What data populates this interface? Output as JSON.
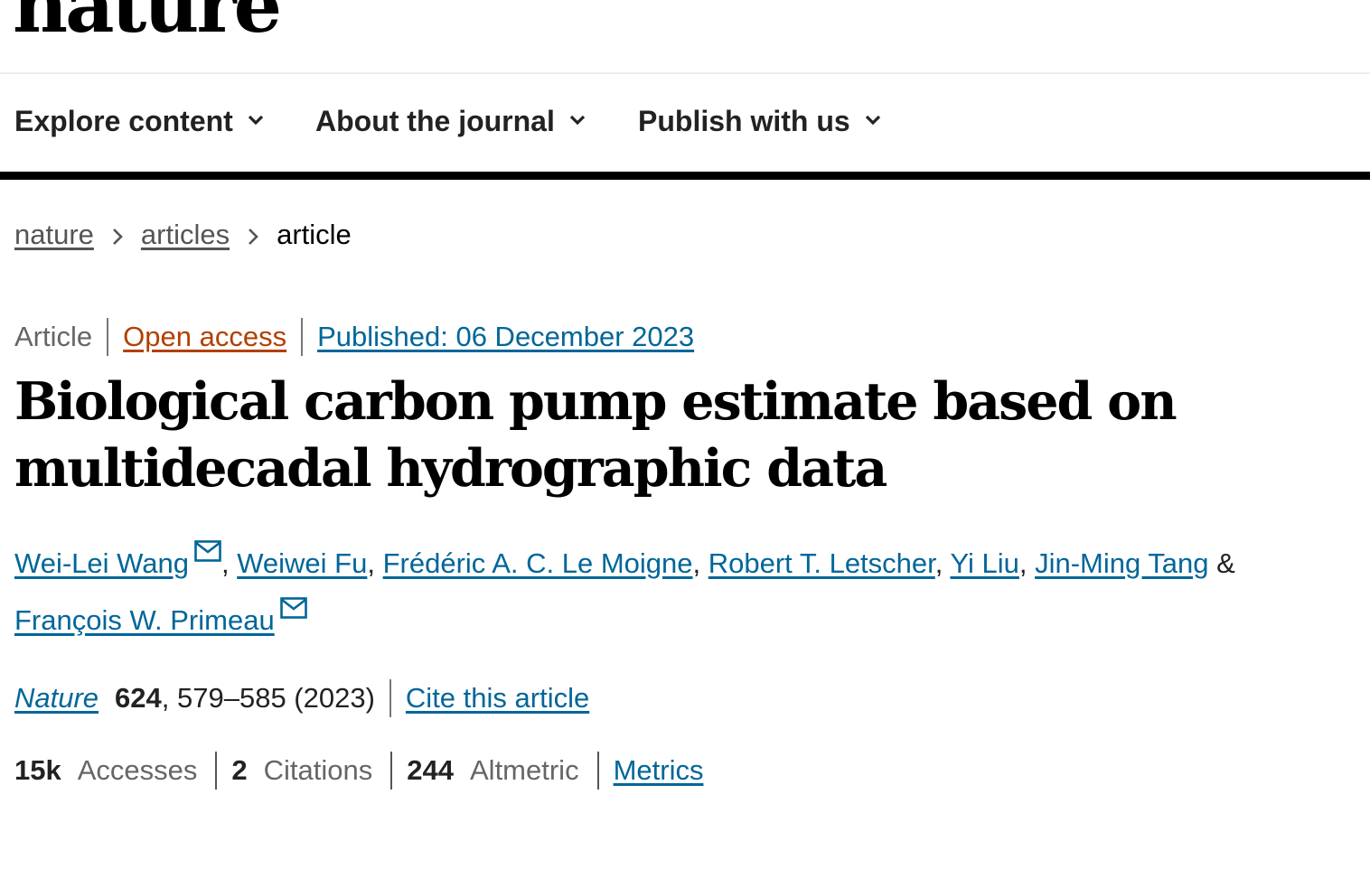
{
  "header": {
    "logo_text": "nature"
  },
  "nav": {
    "items": [
      {
        "label": "Explore content"
      },
      {
        "label": "About the journal"
      },
      {
        "label": "Publish with us"
      }
    ]
  },
  "breadcrumb": {
    "items": [
      "nature",
      "articles"
    ],
    "current": "article"
  },
  "article": {
    "type": "Article",
    "access": "Open access",
    "published": "Published: 06 December 2023",
    "title": "Biological carbon pump estimate based on multidecadal hydrographic data",
    "authors": [
      {
        "name": "Wei-Lei Wang",
        "corresponding": true
      },
      {
        "name": "Weiwei Fu",
        "corresponding": false
      },
      {
        "name": "Frédéric A. C. Le Moigne",
        "corresponding": false
      },
      {
        "name": "Robert T. Letscher",
        "corresponding": false
      },
      {
        "name": "Yi Liu",
        "corresponding": false
      },
      {
        "name": "Jin-Ming Tang",
        "corresponding": false
      },
      {
        "name": "François W. Primeau",
        "corresponding": true
      }
    ],
    "author_separator": ",",
    "author_last_separator": "&"
  },
  "citation": {
    "journal": "Nature",
    "volume": "624",
    "pages_year": ", 579–585 (2023)",
    "cite_label": "Cite this article"
  },
  "metrics": {
    "accesses_value": "15k",
    "accesses_label": "Accesses",
    "citations_value": "2",
    "citations_label": "Citations",
    "altmetric_value": "244",
    "altmetric_label": "Altmetric",
    "metrics_link": "Metrics"
  },
  "colors": {
    "link": "#006699",
    "open_access": "#b33f00",
    "text": "#222222",
    "muted": "#666666"
  },
  "icons": {
    "nav_chevron": "chevron-down-icon",
    "breadcrumb_separator": "chevron-right-icon",
    "corresponding_author": "mail-icon"
  }
}
